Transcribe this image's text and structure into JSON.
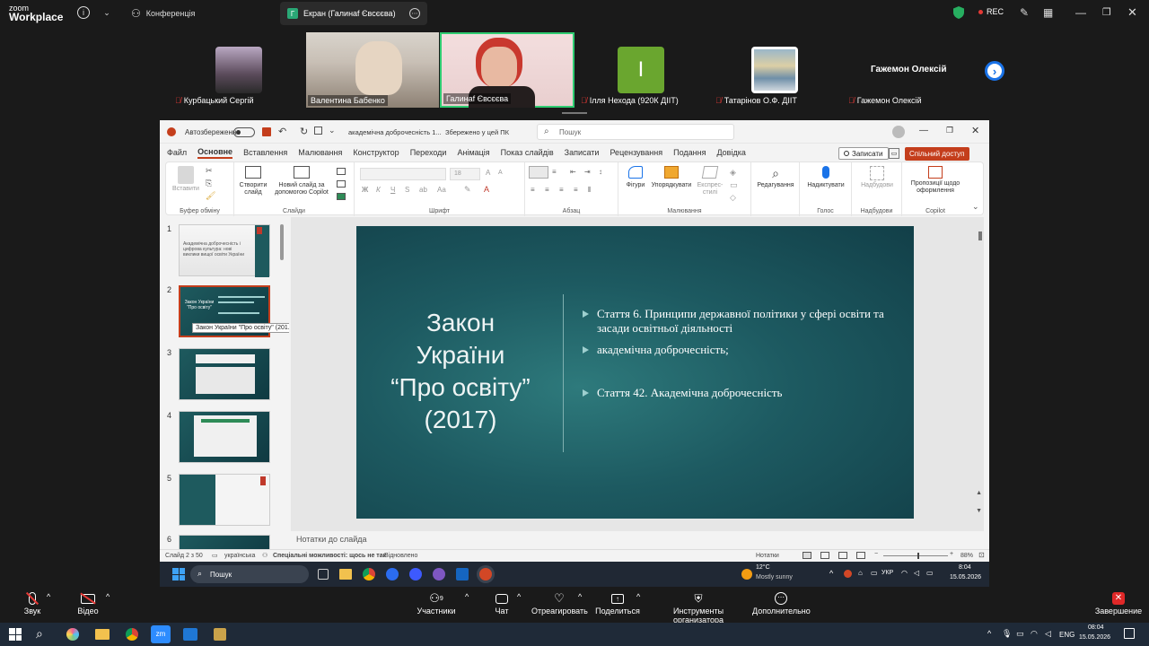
{
  "zoom": {
    "logo_line1": "zoom",
    "logo_line2": "Workplace",
    "tab_conference": "Конференція",
    "tab_screen": "Екран (Галинаf Євсєєва)",
    "rec": "REC"
  },
  "participants": [
    {
      "name": "Курбацький Сергій"
    },
    {
      "name": "Валентина Бабенко"
    },
    {
      "name": "Галинаf Євсєєва"
    },
    {
      "name": "Ілля Нехода (920К ДІІТ)",
      "initial": "І"
    },
    {
      "name": "Татарінов О.Ф. ДІІТ"
    },
    {
      "name": "Гажемон Олексій",
      "big": "Гажемон Олексій"
    }
  ],
  "ppt": {
    "autosave": "Автозбереження",
    "doc_name": "академічна доброчесність 1...",
    "saved": "Збережено у цей ПК",
    "search_placeholder": "Пошук",
    "record": "Записати",
    "share": "Спільний доступ",
    "menu": [
      "Файл",
      "Основне",
      "Вставлення",
      "Малювання",
      "Конструктор",
      "Переходи",
      "Анімація",
      "Показ слайдів",
      "Записати",
      "Рецензування",
      "Подання",
      "Довідка"
    ],
    "ribbon": {
      "paste": "Вставити",
      "clipboard": "Буфер обміну",
      "new_slide": "Створити слайд",
      "copilot_slide": "Новий слайд за допомогою Copilot",
      "slides": "Слайди",
      "font_size": "18",
      "font": "Шрифт",
      "paragraph": "Абзац",
      "shapes": "Фігури",
      "arrange": "Упорядкувати",
      "quick_styles": "Експрес-стилі",
      "drawing": "Малювання",
      "editing": "Редагування",
      "dictate": "Надиктувати",
      "voice": "Голос",
      "addins_btn": "Надбудови",
      "addins": "Надбудови",
      "designer": "Пропозиції щодо оформлення",
      "copilot": "Copilot"
    },
    "thumb_numbers": [
      "1",
      "2",
      "3",
      "4",
      "5",
      "6"
    ],
    "thumb1_text": "Академічна доброчесність і цифрова культура: нові виклики вищої освіти України",
    "thumb2_title": "Закон України “Про освіту”",
    "tooltip": "Закон України \"Про освіту\" (201...",
    "slide": {
      "title_lines": [
        "Закон",
        "України",
        "“Про освіту”",
        "(2017)"
      ],
      "bullets": [
        "Стаття 6. Принципи державної політики у сфері освіти та засади освітньої діяльності",
        "академічна доброчесність;",
        "Стаття 42. Академічна доброчесність"
      ]
    },
    "notes": "Нотатки до слайда",
    "status": {
      "slide_of": "Слайд 2 з 50",
      "lang": "українська",
      "accessibility": "Спеціальні можливості: щось не так",
      "restored": "Відновлено",
      "notes_btn": "Нотатки",
      "zoom": "88%"
    }
  },
  "win_inner": {
    "search": "Пошук",
    "temp": "12°C",
    "weather": "Mostly sunny",
    "lang": "УКР",
    "time": "8:04",
    "date": "15.05.2026"
  },
  "zoom_bottom": {
    "audio": "Звук",
    "video": "Відео",
    "participants": "Участники",
    "participants_count": "9",
    "chat": "Чат",
    "react": "Отреагировать",
    "share": "Поделиться",
    "host_tools": "Инструменты организатора",
    "more": "Дополнительно",
    "end": "Завершение"
  },
  "host_task": {
    "lang": "ENG",
    "time": "08:04",
    "date": "15.05.2026"
  }
}
